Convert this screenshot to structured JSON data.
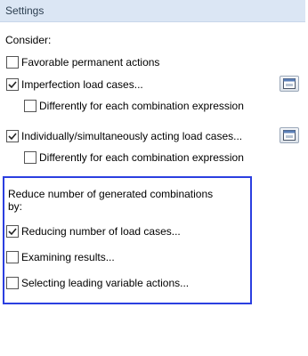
{
  "header": {
    "title": "Settings"
  },
  "consider_label": "Consider:",
  "options": {
    "favorable": {
      "label": "Favorable permanent actions",
      "checked": false
    },
    "imperfection": {
      "label": "Imperfection load cases...",
      "checked": true
    },
    "imperfection_diff": {
      "label": "Differently for each combination expression",
      "checked": false
    },
    "individually": {
      "label": "Individually/simultaneously acting load cases...",
      "checked": true
    },
    "individually_diff": {
      "label": "Differently for each combination expression",
      "checked": false
    }
  },
  "reduce": {
    "heading_line1": "Reduce number of generated combinations",
    "heading_line2": "by:",
    "reducing": {
      "label": "Reducing number of load cases...",
      "checked": true
    },
    "examining": {
      "label": "Examining results...",
      "checked": false
    },
    "selecting": {
      "label": "Selecting leading variable actions...",
      "checked": false
    }
  },
  "icons": {
    "edit_button_icon": "edit-dialog-icon"
  },
  "colors": {
    "header_bg": "#dbe6f4",
    "highlight_border": "#2b3fe0"
  }
}
